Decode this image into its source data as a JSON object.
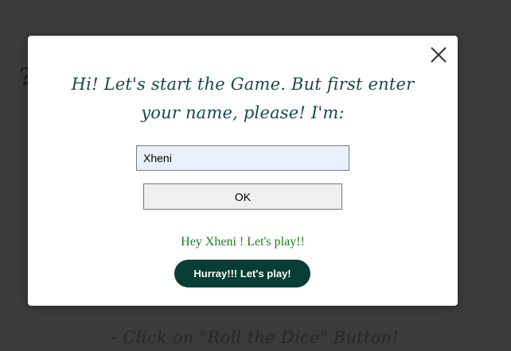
{
  "background": {
    "instruction_text": "- Click on \"Roll the Dice\" Button!"
  },
  "modal": {
    "close_icon": "close-icon",
    "prompt": "Hi! Let's start the Game. But first enter your name, please! I'm:",
    "name_input": {
      "value": "Xheni"
    },
    "ok_label": "OK",
    "greeting": "Hey Xheni ! Let's play!!",
    "play_label": "Hurray!!! Let's play!"
  },
  "colors": {
    "backdrop": "#3d3b39",
    "prompt_text": "#174a45",
    "greeting_text": "#1c7a24",
    "play_button": "#073d34",
    "input_fill": "#e8f0fe"
  }
}
